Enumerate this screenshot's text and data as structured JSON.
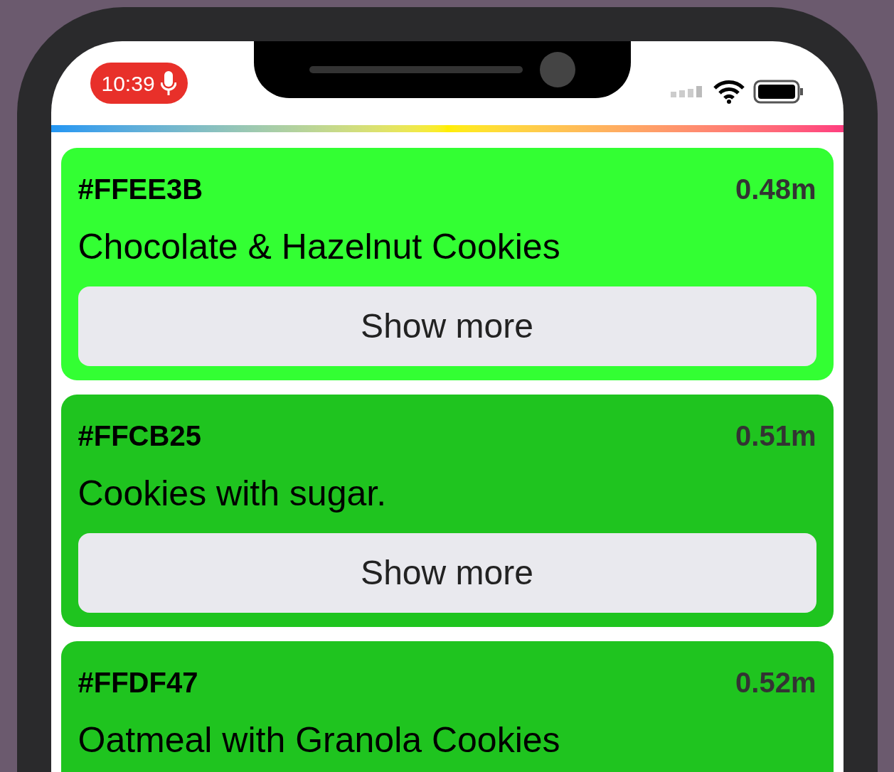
{
  "status_bar": {
    "time": "10:39",
    "recording": true
  },
  "cards": [
    {
      "code": "#FFEE3B",
      "time": "0.48m",
      "title": "Chocolate & Hazelnut Cookies",
      "button": "Show more",
      "color": "#33ff33"
    },
    {
      "code": "#FFCB25",
      "time": "0.51m",
      "title": "Cookies with sugar.",
      "button": "Show more",
      "color": "#1fc41f"
    },
    {
      "code": "#FFDF47",
      "time": "0.52m",
      "title": "Oatmeal with Granola Cookies",
      "color": "#1fc41f"
    }
  ]
}
